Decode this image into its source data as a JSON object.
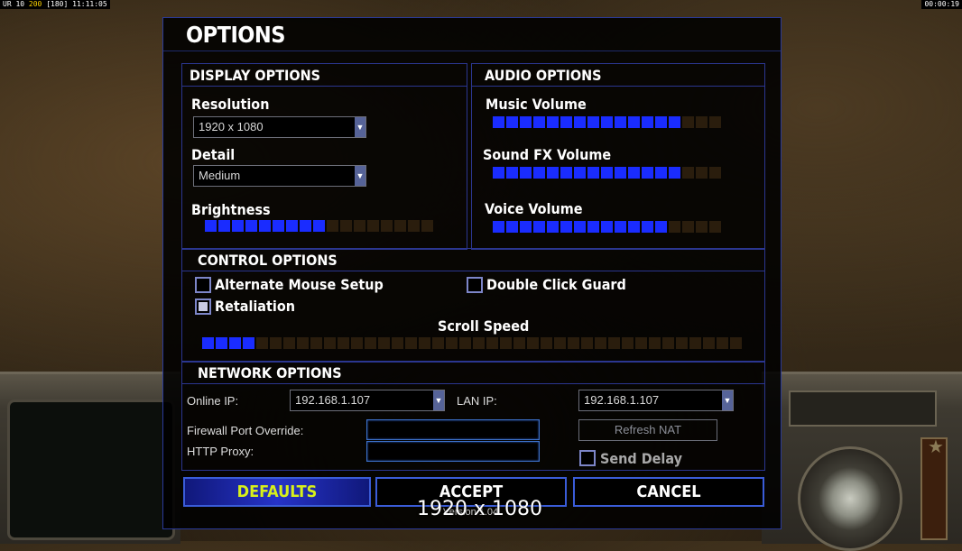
{
  "status_bar": {
    "left_a": "UR 10",
    "left_b": "200",
    "left_c": "[180]",
    "clock": "11:11:05",
    "timer": "00:00:19"
  },
  "dialog": {
    "title": "OPTIONS",
    "version": "Version 1.04",
    "overlay_resolution": "1920 x 1080"
  },
  "display": {
    "title": "DISPLAY OPTIONS",
    "resolution_label": "Resolution",
    "resolution_value": "1920 x 1080",
    "detail_label": "Detail",
    "detail_value": "Medium",
    "brightness_label": "Brightness",
    "brightness_level": 0.5
  },
  "audio": {
    "title": "AUDIO OPTIONS",
    "music_label": "Music Volume",
    "music_level": 0.8,
    "sfx_label": "Sound FX Volume",
    "sfx_level": 0.85,
    "voice_label": "Voice Volume",
    "voice_level": 0.75
  },
  "control": {
    "title": "CONTROL OPTIONS",
    "alt_mouse_label": "Alternate Mouse Setup",
    "alt_mouse_checked": false,
    "double_click_label": "Double Click Guard",
    "double_click_checked": false,
    "retaliation_label": "Retaliation",
    "retaliation_checked": true,
    "scroll_label": "Scroll Speed",
    "scroll_level": 0.1
  },
  "network": {
    "title": "NETWORK OPTIONS",
    "online_ip_label": "Online IP:",
    "online_ip_value": "192.168.1.107",
    "lan_ip_label": "LAN IP:",
    "lan_ip_value": "192.168.1.107",
    "firewall_label": "Firewall Port Override:",
    "proxy_label": "HTTP Proxy:",
    "refresh_label": "Refresh NAT",
    "send_delay_label": "Send Delay",
    "send_delay_checked": false
  },
  "buttons": {
    "defaults": "DEFAULTS",
    "accept": "ACCEPT",
    "cancel": "CANCEL"
  },
  "colors": {
    "bar_on": "#1a2cff",
    "bar_off": "#2a1d0d",
    "panel_border": "#2b3690",
    "defaults_text": "#d7f01a"
  }
}
